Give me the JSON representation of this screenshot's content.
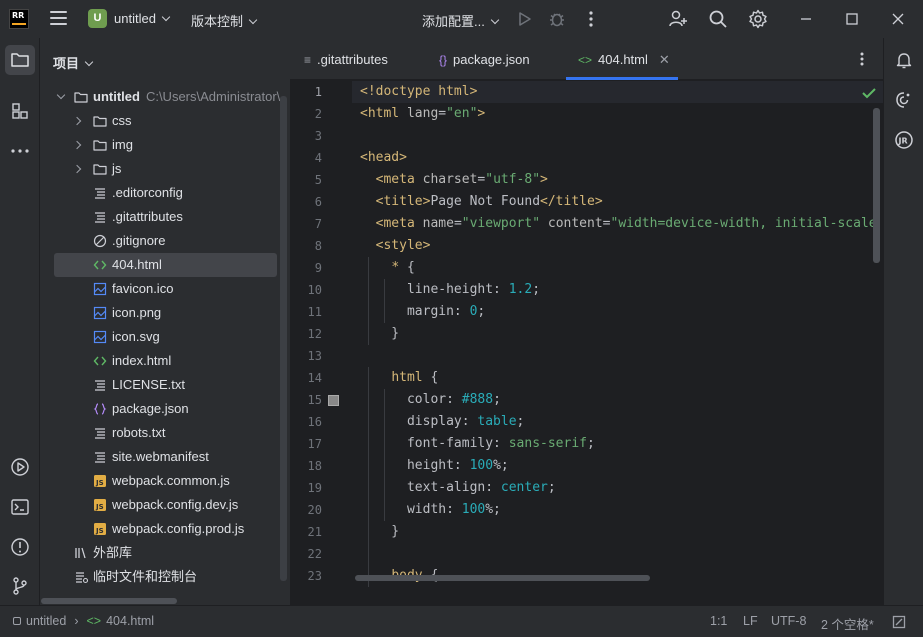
{
  "titlebar": {
    "logo_text": "RR",
    "project_initial": "U",
    "project_name": "untitled",
    "vcs_label": "版本控制",
    "run_config_label": "添加配置..."
  },
  "sidebar_title": "项目",
  "project_tree": {
    "root_label": "untitled",
    "root_path": "C:\\Users\\Administrator\\",
    "folders": [
      "css",
      "img",
      "js"
    ],
    "files": [
      {
        "name": ".editorconfig",
        "icon": "text-file-icon"
      },
      {
        "name": ".gitattributes",
        "icon": "text-file-icon"
      },
      {
        "name": ".gitignore",
        "icon": "ignore-file-icon"
      },
      {
        "name": "404.html",
        "icon": "html-file-icon"
      },
      {
        "name": "favicon.ico",
        "icon": "image-file-icon"
      },
      {
        "name": "icon.png",
        "icon": "image-file-icon"
      },
      {
        "name": "icon.svg",
        "icon": "image-file-icon"
      },
      {
        "name": "index.html",
        "icon": "html-file-icon"
      },
      {
        "name": "LICENSE.txt",
        "icon": "text-file-icon"
      },
      {
        "name": "package.json",
        "icon": "json-file-icon"
      },
      {
        "name": "robots.txt",
        "icon": "text-file-icon"
      },
      {
        "name": "site.webmanifest",
        "icon": "text-file-icon"
      },
      {
        "name": "webpack.common.js",
        "icon": "js-file-icon"
      },
      {
        "name": "webpack.config.dev.js",
        "icon": "js-file-icon"
      },
      {
        "name": "webpack.config.prod.js",
        "icon": "js-file-icon"
      }
    ],
    "external_libs": "外部库",
    "scratches": "临时文件和控制台"
  },
  "tabs": [
    {
      "label": ".gitattributes",
      "icon": "text-file-icon"
    },
    {
      "label": "package.json",
      "icon": "json-file-icon"
    },
    {
      "label": "404.html",
      "icon": "html-file-icon",
      "active": true
    }
  ],
  "editor": {
    "line_numbers": [
      "1",
      "2",
      "3",
      "4",
      "5",
      "6",
      "7",
      "8",
      "9",
      "10",
      "11",
      "12",
      "13",
      "14",
      "15",
      "16",
      "17",
      "18",
      "19",
      "20",
      "21",
      "22",
      "23"
    ],
    "swatch_color": "#888888"
  },
  "statusbar": {
    "breadcrumb_project": "untitled",
    "breadcrumb_file": "404.html",
    "position": "1:1",
    "line_ending": "LF",
    "encoding": "UTF-8",
    "indent": "2 个空格*"
  }
}
